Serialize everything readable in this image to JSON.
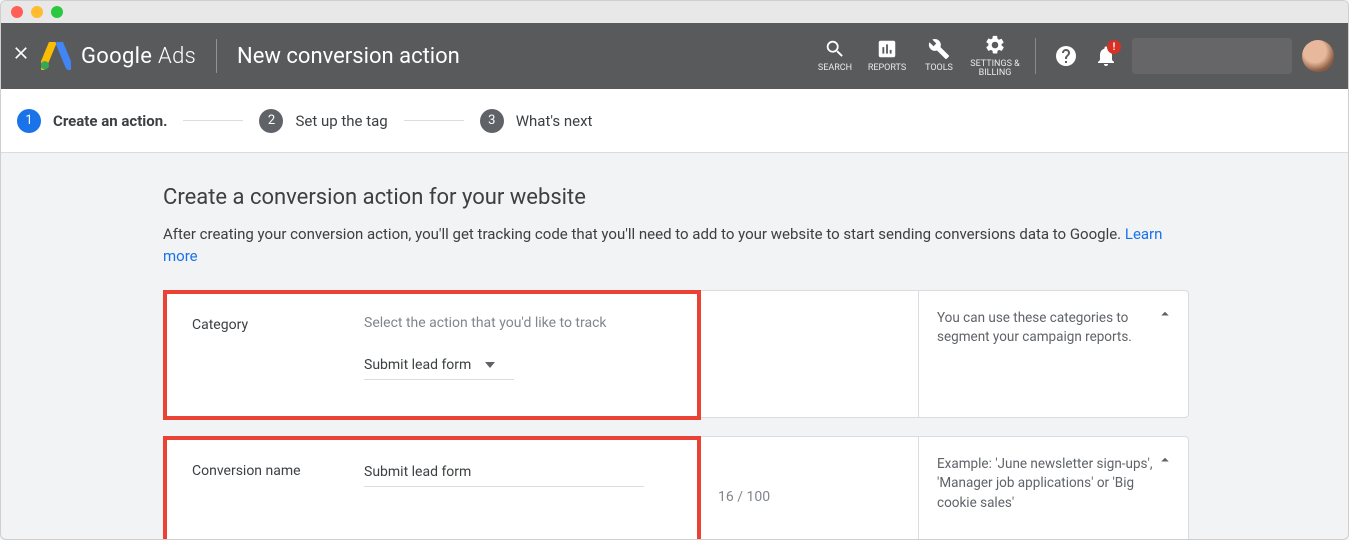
{
  "header": {
    "product_html": "Google Ads",
    "product_first": "Google",
    "product_second": "Ads",
    "page_title": "New conversion action",
    "tools": {
      "search": "SEARCH",
      "reports": "REPORTS",
      "tools": "TOOLS",
      "settings": "SETTINGS & BILLING"
    },
    "notif_badge": "!"
  },
  "stepper": {
    "steps": [
      {
        "num": "1",
        "label": "Create an action."
      },
      {
        "num": "2",
        "label": "Set up the tag"
      },
      {
        "num": "3",
        "label": "What's next"
      }
    ]
  },
  "content": {
    "title": "Create a conversion action for your website",
    "description_start": "After creating your conversion action, you'll get tracking code that you'll need to add to your website to start sending conversions data to Google. ",
    "learn_more": "Learn more"
  },
  "category_card": {
    "label": "Category",
    "hint": "Select the action that you'd like to track",
    "dropdown_value": "Submit lead form",
    "right_text": "You can use these categories to segment your campaign reports."
  },
  "name_card": {
    "label": "Conversion name",
    "value": "Submit lead form",
    "counter": "16 / 100",
    "right_text": "Example: 'June newsletter sign-ups', 'Manager job applications' or 'Big cookie sales'"
  }
}
